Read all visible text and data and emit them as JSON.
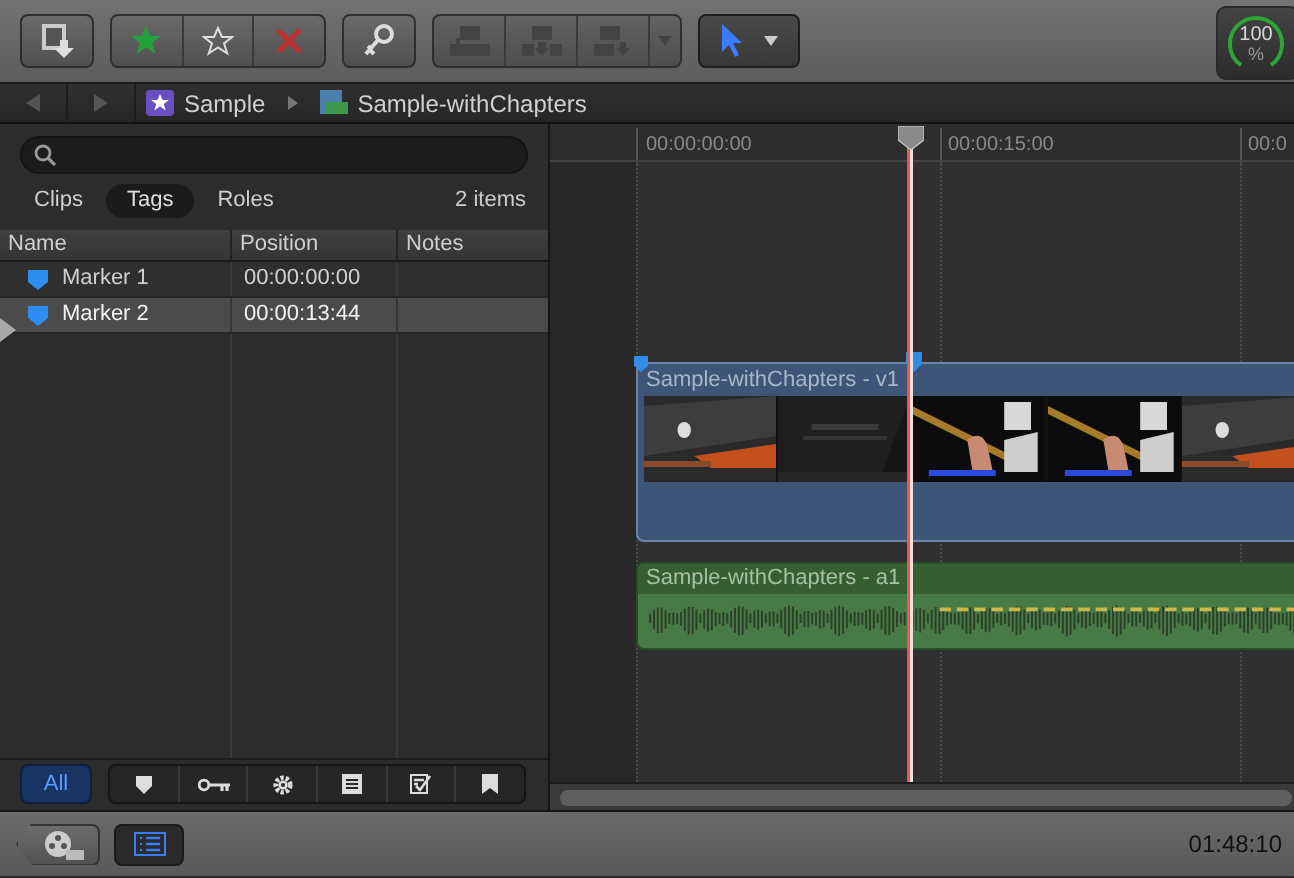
{
  "toolbar": {
    "zoom_meter": {
      "reading": "100",
      "unit": "%",
      "level": 1
    }
  },
  "breadcrumb": [
    {
      "kind": "event",
      "label": "Sample"
    },
    {
      "kind": "project",
      "label": "Sample-withChapters"
    }
  ],
  "filter_tabs": [
    {
      "label": "Clips",
      "selected": false
    },
    {
      "label": "Tags",
      "selected": true
    },
    {
      "label": "Roles",
      "selected": false
    }
  ],
  "item_count": "2 items",
  "table": {
    "columns": [
      "Name",
      "Position",
      "Notes"
    ],
    "rows": [
      {
        "name": "Marker 1",
        "position": "00:00:00:00",
        "selected": false
      },
      {
        "name": "Marker 2",
        "position": "00:00:13:44",
        "selected": true
      }
    ]
  },
  "tag_filter": {
    "label": "All",
    "selected": true
  },
  "timeline": {
    "ruler": [
      "00:00:00:00",
      "00:00:15:00",
      "00:0"
    ],
    "clips": [
      {
        "kind": "video",
        "title": "Sample-withChapters - v1"
      },
      {
        "kind": "audio",
        "title": "Sample-withChapters - a1"
      }
    ]
  },
  "status_bar": {
    "duration": "01:48:10"
  }
}
